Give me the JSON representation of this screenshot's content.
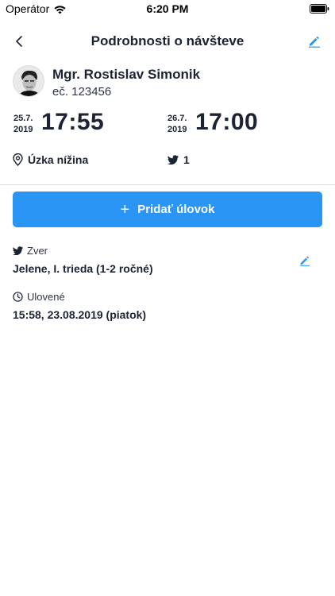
{
  "status_bar": {
    "carrier": "Operátor",
    "time": "6:20 PM"
  },
  "nav": {
    "title": "Podrobnosti o návšteve",
    "accent_color": "#2b95f5"
  },
  "hunter": {
    "name": "Mgr. Rostislav Simonik",
    "id_label": "eč. 123456"
  },
  "from": {
    "date_day": "25.7.",
    "date_year": "2019",
    "time": "17:55"
  },
  "to": {
    "date_day": "26.7.",
    "date_year": "2019",
    "time": "17:00"
  },
  "location": {
    "name": "Úzka nížina",
    "icon": "location-pin-icon"
  },
  "catch_count": {
    "value": "1",
    "icon": "bird-icon"
  },
  "add_button": {
    "label": "Pridať úlovok",
    "color": "#2b95f5"
  },
  "catch_item": {
    "game_label": "Zver",
    "game_value": "Jelene, I. trieda (1-2 ročné)",
    "caught_label": "Ulovené",
    "caught_value": "15:58, 23.08.2019 (piatok)"
  }
}
